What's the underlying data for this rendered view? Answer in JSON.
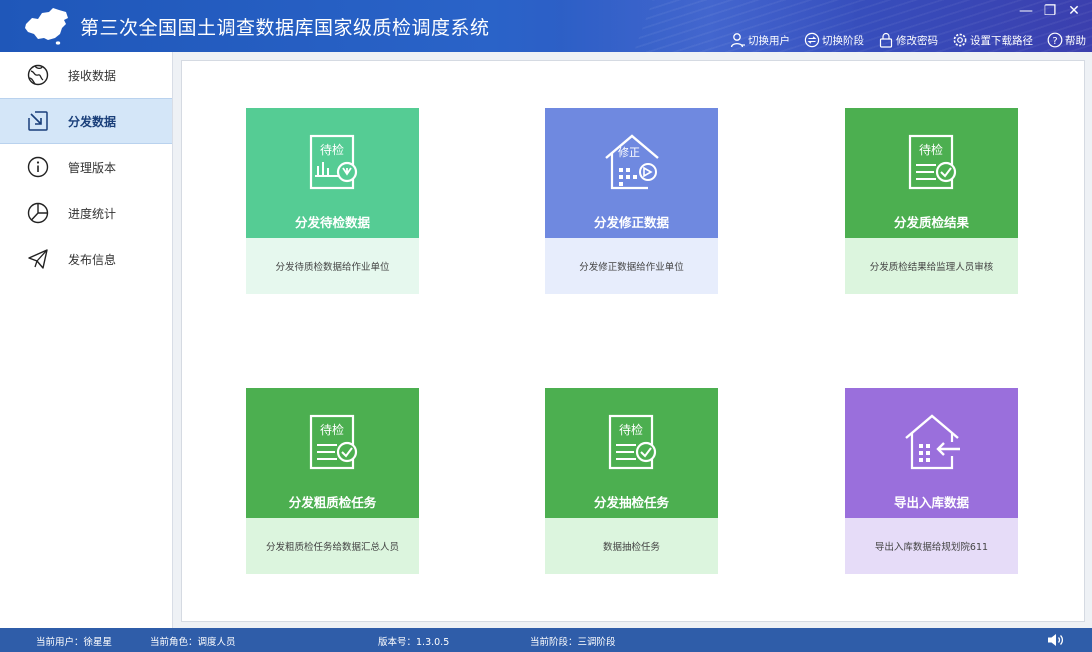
{
  "app": {
    "title": "第三次全国国土调查数据库国家级质检调度系统",
    "window_controls": [
      "—",
      "❐",
      "✕"
    ]
  },
  "toolbar": {
    "items": [
      {
        "label": "切换用户",
        "icon": "user-switch-icon"
      },
      {
        "label": "切换阶段",
        "icon": "stage-switch-icon"
      },
      {
        "label": "修改密码",
        "icon": "lock-icon"
      },
      {
        "label": "设置下载路径",
        "icon": "gear-icon"
      },
      {
        "label": "帮助",
        "icon": "help-icon"
      }
    ]
  },
  "sidebar": {
    "items": [
      {
        "label": "接收数据",
        "icon": "globe-icon",
        "active": false
      },
      {
        "label": "分发数据",
        "icon": "distribute-icon",
        "active": true
      },
      {
        "label": "管理版本",
        "icon": "info-icon",
        "active": false
      },
      {
        "label": "进度统计",
        "icon": "pie-chart-icon",
        "active": false
      },
      {
        "label": "发布信息",
        "icon": "send-icon",
        "active": false
      }
    ]
  },
  "cards": [
    {
      "title": "分发待检数据",
      "description": "分发待质检数据给作业单位",
      "icon_text": "待检",
      "icon": "pending-check-icon",
      "color": "#55cc94",
      "bottom_color": "#e6f8ee"
    },
    {
      "title": "分发修正数据",
      "description": "分发修正数据给作业单位",
      "icon_text": "修正",
      "icon": "correction-building-icon",
      "color": "#6f89e0",
      "bottom_color": "#e7edfc"
    },
    {
      "title": "分发质检结果",
      "description": "分发质检结果给监理人员审核",
      "icon_text": "待检",
      "icon": "check-result-icon",
      "color": "#4caf50",
      "bottom_color": "#dcf5de"
    },
    {
      "title": "分发粗质检任务",
      "description": "分发粗质检任务给数据汇总人员",
      "icon_text": "待检",
      "icon": "rough-check-task-icon",
      "color": "#4caf50",
      "bottom_color": "#dcf5de"
    },
    {
      "title": "分发抽检任务",
      "description": "数据抽检任务",
      "icon_text": "待检",
      "icon": "sample-check-task-icon",
      "color": "#4caf50",
      "bottom_color": "#dcf5de"
    },
    {
      "title": "导出入库数据",
      "description": "导出入库数据给规划院611",
      "icon_text": "",
      "icon": "export-building-icon",
      "color": "#9a6fdc",
      "bottom_color": "#e6dcf8"
    }
  ],
  "status": {
    "user": "当前用户：徐星星",
    "role": "当前角色：调度人员",
    "version": "版本号：1.3.0.5",
    "stage": "当前阶段：三调阶段"
  }
}
